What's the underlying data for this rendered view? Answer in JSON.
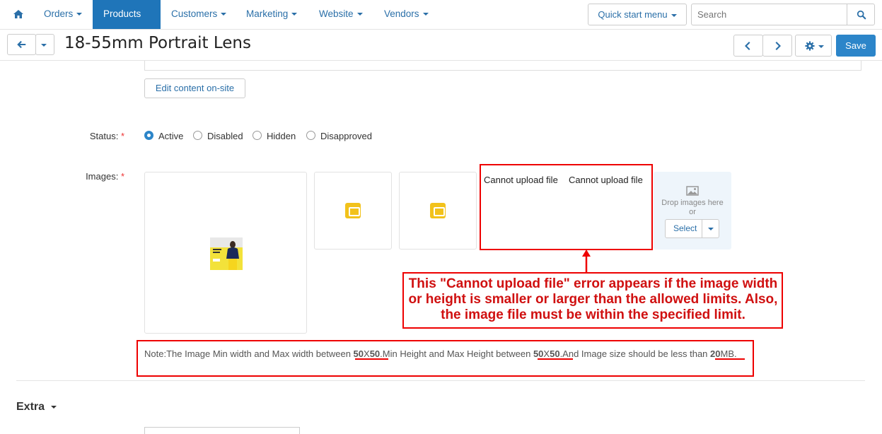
{
  "nav": {
    "items": [
      "Orders",
      "Products",
      "Customers",
      "Marketing",
      "Website",
      "Vendors"
    ],
    "active": "Products",
    "quick_start": "Quick start menu",
    "search_placeholder": "Search"
  },
  "title": "18-55mm Portrait Lens",
  "save_label": "Save",
  "edit_content_label": "Edit content on-site",
  "status": {
    "label": "Status:",
    "options": [
      "Active",
      "Disabled",
      "Hidden",
      "Disapproved"
    ],
    "selected": "Active"
  },
  "images": {
    "label": "Images:",
    "error_1": "Cannot upload file",
    "error_2": "Cannot upload file",
    "drop_text": "Drop images here",
    "or_text": "or",
    "select_label": "Select"
  },
  "annotation": {
    "line1": "This \"Cannot upload file\" error appears if the image width",
    "line2": "or height is smaller or larger than the allowed limits. Also,",
    "line3": "the image file must be within the specified limit."
  },
  "note": {
    "part1": "Note:The Image Min width and Max width between ",
    "v1a": "50",
    "v1b": "X",
    "v1c": "50",
    "part2": ".Min Height and Max Height between ",
    "v2a": "50",
    "v2b": "X",
    "v2c": "50",
    "part3": ".And Image size should be less than ",
    "v3a": "20",
    "v3b": "MB."
  },
  "extra_label": "Extra",
  "colors": {
    "accent": "#1f75b9",
    "save": "#2c85c9",
    "annotation_red": "#e00000"
  }
}
